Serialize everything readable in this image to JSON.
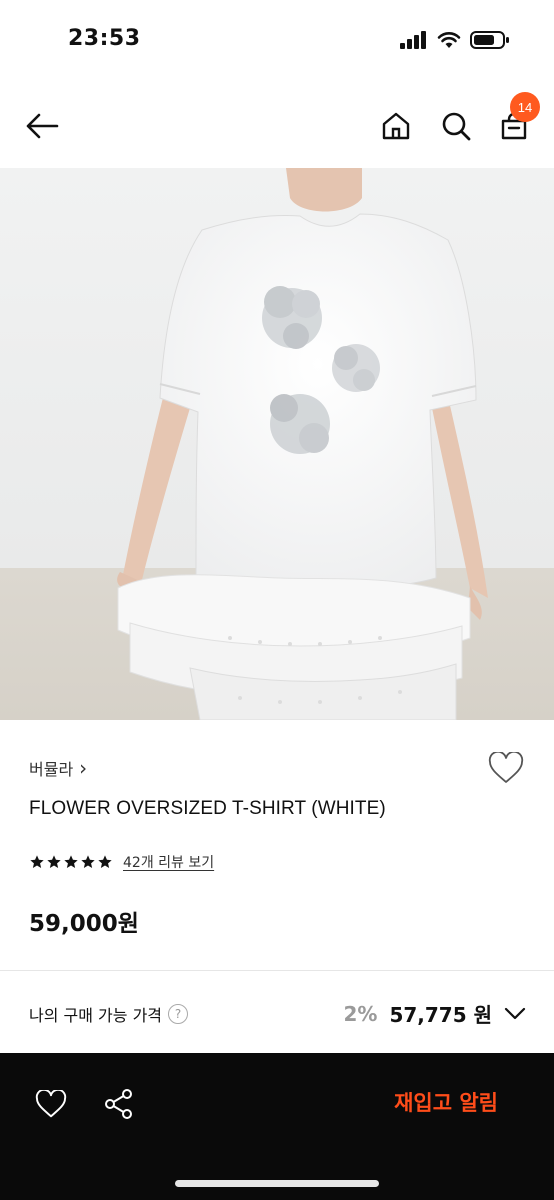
{
  "status_bar": {
    "time": "23:53"
  },
  "nav": {
    "cart_count": "14"
  },
  "product": {
    "brand": "버뮬라",
    "brand_chevron": "›",
    "name": "FLOWER OVERSIZED T-SHIRT (WHITE)",
    "rating_stars": 5,
    "review_link": "42개 리뷰 보기",
    "price": "59,000원"
  },
  "my_price": {
    "label": "나의 구매 가능 가격",
    "help": "?",
    "discount": "2%",
    "price": "57,775 원"
  },
  "bottom_bar": {
    "restock_label": "재입고 알림"
  },
  "colors": {
    "accent": "#ff4d1a",
    "badge": "#ff5a1f",
    "bottom_bar": "#0a0a0a"
  }
}
